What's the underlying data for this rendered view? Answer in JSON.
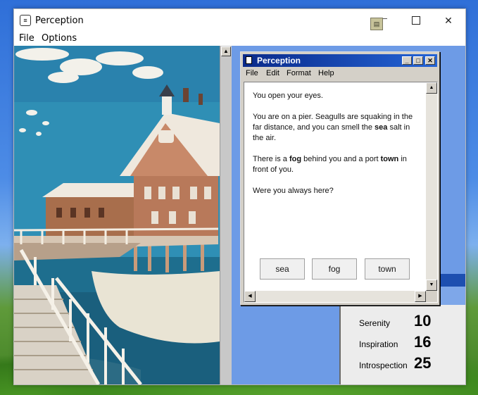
{
  "app": {
    "title": "Perception",
    "menu": [
      "File",
      "Options"
    ]
  },
  "notepad": {
    "title": "Perception",
    "menu": [
      "File",
      "Edit",
      "Format",
      "Help"
    ],
    "line1": "You open your eyes.",
    "p2_a": "You are on a pier. Seagulls are squaking in the far distance, and you can smell the ",
    "p2_bold": "sea",
    "p2_b": " salt in the air.",
    "p3_a": "There is a ",
    "p3_bold1": "fog",
    "p3_b": " behind you and a port ",
    "p3_bold2": "town",
    "p3_c": " in front of you.",
    "line4": "Were you always here?",
    "choices": [
      "sea",
      "fog",
      "town"
    ]
  },
  "stats": [
    {
      "label": "Serenity",
      "value": "10"
    },
    {
      "label": "Inspiration",
      "value": "16"
    },
    {
      "label": "Introspection",
      "value": "25"
    }
  ],
  "colors": {
    "titlebar_blue": "#0a2a8a",
    "stats_bar": "#1d4fb0",
    "desktop_blue": "#6d9be6"
  },
  "icons": {
    "app": "notepad-icon",
    "tray": "tray-app-icon"
  }
}
